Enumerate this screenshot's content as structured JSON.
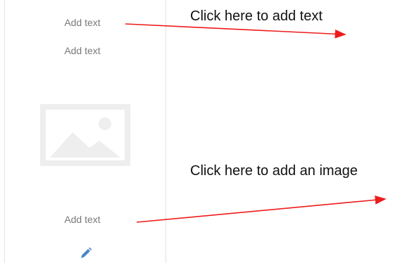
{
  "panel": {
    "text_top": "Add text",
    "text_second": "Add text",
    "text_bottom": "Add text",
    "image_icon": "image-placeholder-icon",
    "edit_icon": "pencil-icon"
  },
  "annotations": {
    "add_text_note": "Click here to add text",
    "add_image_note": "Click here to add an image",
    "arrow_color": "#ee1c1c"
  },
  "colors": {
    "placeholder_text": "#7a7a7a",
    "placeholder_image": "#eeeeee",
    "edit_icon": "#4a86c8"
  }
}
